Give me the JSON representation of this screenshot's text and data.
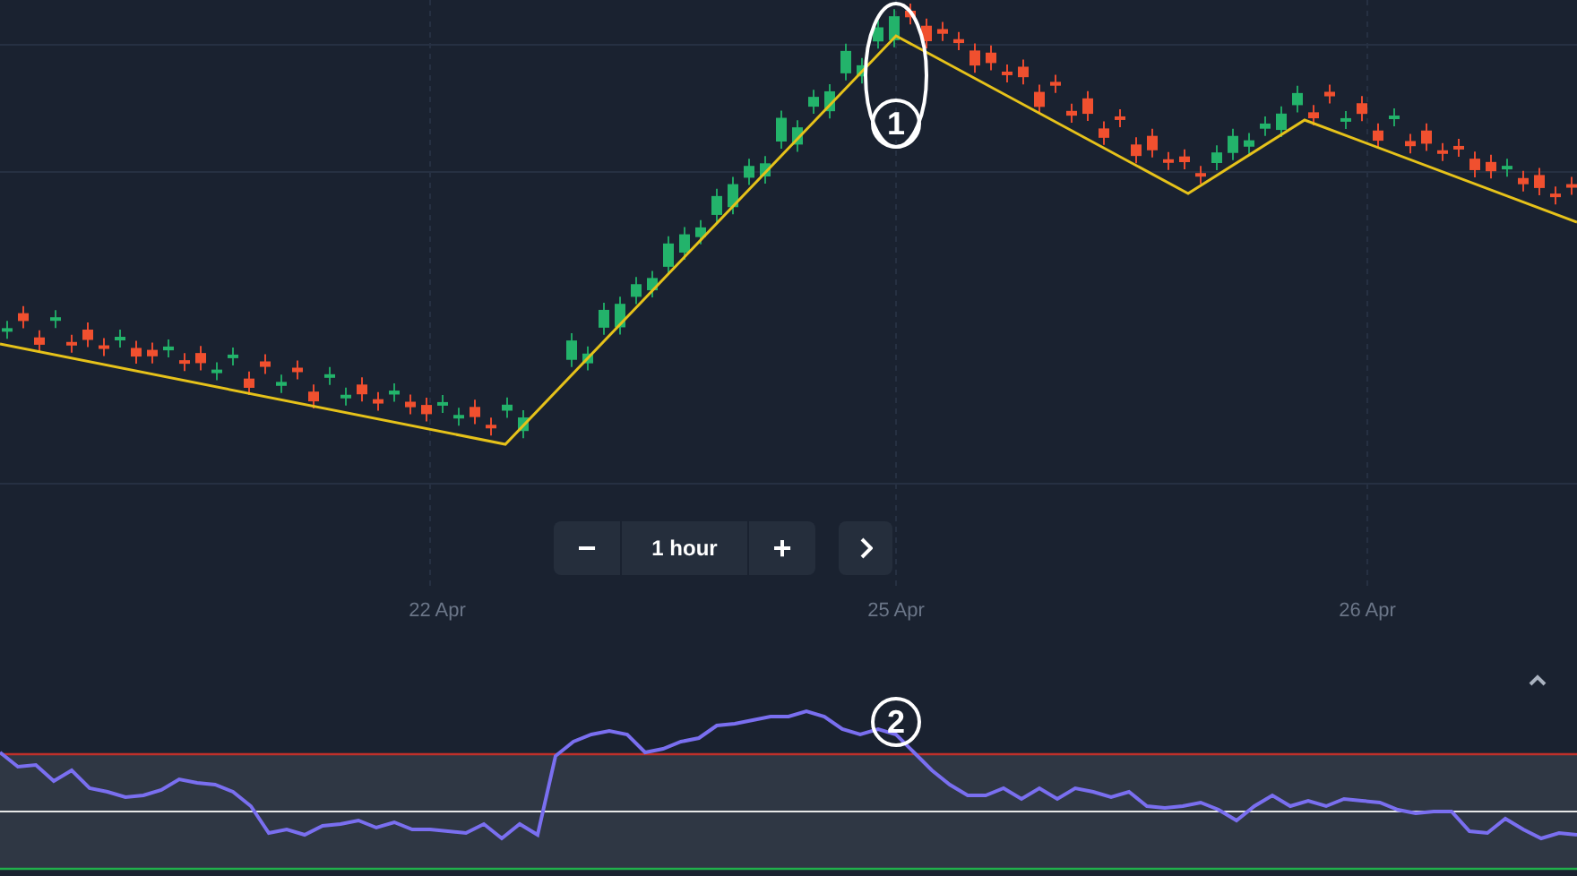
{
  "chart": {
    "annotations": [
      {
        "label": "1"
      },
      {
        "label": "2"
      }
    ],
    "x_labels": [
      "22 Apr",
      "25 Apr",
      "26 Apr"
    ]
  },
  "zoom_controls": {
    "decrease": "−",
    "interval": "1 hour",
    "increase": "+"
  }
}
